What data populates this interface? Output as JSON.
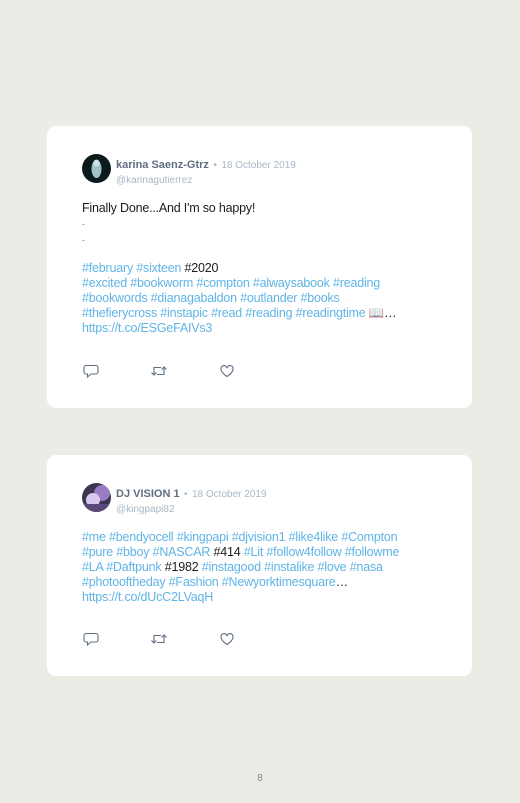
{
  "tweets": [
    {
      "author": "karina Saenz-Gtrz",
      "separator": "•",
      "date": "18 October 2019",
      "handle": "@karinagutierrez",
      "lines": [
        [
          {
            "t": "Finally Done...And I'm so happy!",
            "c": "plain"
          }
        ],
        [
          {
            "t": "-",
            "c": "small"
          }
        ],
        [
          {
            "t": "-",
            "c": "small"
          }
        ],
        [
          {
            "t": "#february",
            "c": "tag"
          },
          {
            "t": " ",
            "c": "plain"
          },
          {
            "t": "#sixteen",
            "c": "tag"
          },
          {
            "t": " #2020",
            "c": "plain"
          }
        ],
        [
          {
            "t": "#excited #bookworm #compton #alwaysabook #reading",
            "c": "tag"
          }
        ],
        [
          {
            "t": "#bookwords #dianagabaldon #outlander #books",
            "c": "tag"
          }
        ],
        [
          {
            "t": "#thefierycross #instapic #read #reading #readingtime",
            "c": "tag"
          },
          {
            "t": " 📖…",
            "c": "plain"
          }
        ],
        [
          {
            "t": "https://t.co/ESGeFAIVs3",
            "c": "link"
          }
        ]
      ]
    },
    {
      "author": "DJ VISION 1",
      "separator": "•",
      "date": "18 October 2019",
      "handle": "@kingpapi82",
      "lines": [
        [
          {
            "t": "#me #bendyocell #kingpapi #djvision1 #like4like #Compton",
            "c": "tag"
          }
        ],
        [
          {
            "t": "#pure #bboy #NASCAR",
            "c": "tag"
          },
          {
            "t": " #414 ",
            "c": "plain"
          },
          {
            "t": "#Lit #follow4follow #followme",
            "c": "tag"
          }
        ],
        [
          {
            "t": "#LA #Daftpunk",
            "c": "tag"
          },
          {
            "t": " #1982 ",
            "c": "plain"
          },
          {
            "t": "#instagood #instalike #love #nasa",
            "c": "tag"
          }
        ],
        [
          {
            "t": "#photooftheday #Fashion #Newyorktimesquare",
            "c": "tag"
          },
          {
            "t": "…",
            "c": "plain"
          }
        ],
        [
          {
            "t": "https://t.co/dUcC2LVaqH",
            "c": "link"
          }
        ]
      ]
    }
  ],
  "icons": {
    "reply": "reply-icon",
    "retweet": "retweet-icon",
    "like": "heart-icon"
  },
  "colors": {
    "background": "#edebe6",
    "card": "#ffffff",
    "hashtag": "#5fb4e6",
    "meta": "#a6b8c8",
    "author": "#5e6e80"
  },
  "page_number": "8"
}
